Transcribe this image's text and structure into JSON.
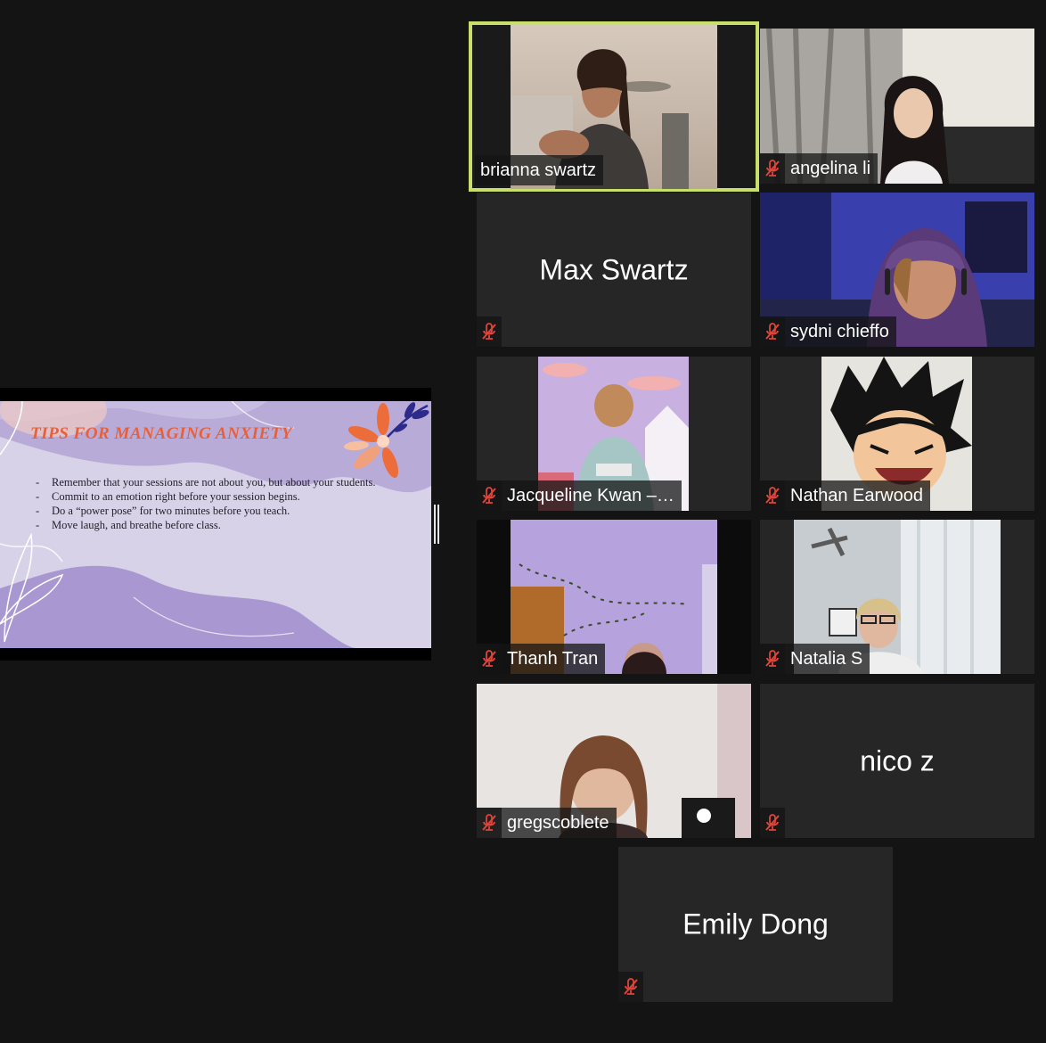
{
  "slide": {
    "title": "TIPS FOR MANAGING ANXIETY",
    "bullets": [
      "Remember that your sessions are not about you, but about your students.",
      "Commit to an emotion right before your session begins.",
      "Do a “power pose” for two minutes before you teach.",
      "Move laugh, and breathe before class."
    ]
  },
  "participants": [
    {
      "name": "brianna swartz",
      "muted": false,
      "video": true,
      "active_speaker": true
    },
    {
      "name": "angelina li",
      "muted": true,
      "video": true
    },
    {
      "name": "Max Swartz",
      "muted": true,
      "video": false
    },
    {
      "name": "sydni chieffo",
      "muted": true,
      "video": true
    },
    {
      "name": "Jacqueline Kwan –…",
      "muted": true,
      "video": true
    },
    {
      "name": "Nathan Earwood",
      "muted": true,
      "video": true
    },
    {
      "name": "Thanh Tran",
      "muted": true,
      "video": true
    },
    {
      "name": "Natalia S",
      "muted": true,
      "video": true
    },
    {
      "name": "gregscoblete",
      "muted": true,
      "video": true
    },
    {
      "name": "nico z",
      "muted": true,
      "video": false
    },
    {
      "name": "Emily Dong",
      "muted": true,
      "video": false
    }
  ],
  "colors": {
    "background": "#141414",
    "tile": "#262626",
    "active_border": "#c8e06a",
    "muted_icon": "#e0443a",
    "slide_title": "#e8603a"
  }
}
